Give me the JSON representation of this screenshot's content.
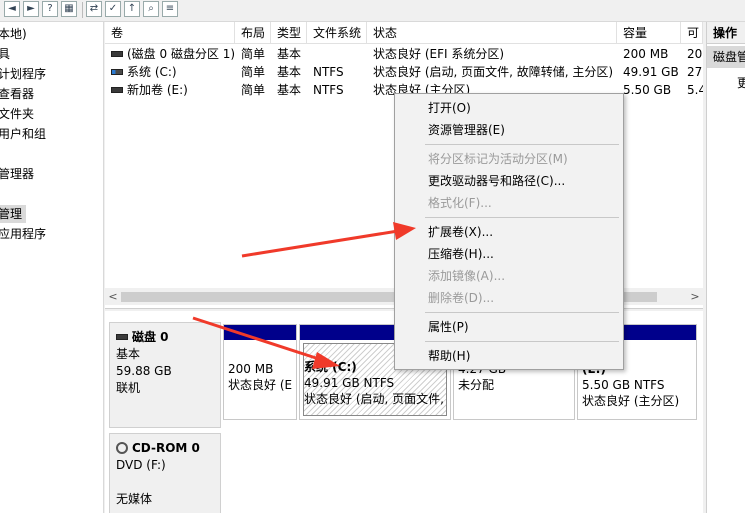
{
  "toolbar": {
    "icons": [
      "back-icon",
      "forward-icon",
      "help-icon",
      "refresh-icon",
      "rescan-icon",
      "check-icon",
      "folder-up-icon",
      "search-icon",
      "properties-icon"
    ]
  },
  "tree": {
    "items": [
      "本地)",
      "具",
      "计划程序",
      "查看器",
      "文件夹",
      "用户和组",
      "管理器",
      "管理",
      "应用程序"
    ]
  },
  "list": {
    "columns": [
      "卷",
      "布局",
      "类型",
      "文件系统",
      "状态",
      "容量",
      "可"
    ],
    "rows": [
      {
        "name": "(磁盘 0 磁盘分区 1)",
        "layout": "简单",
        "type": "基本",
        "fs": "",
        "status": "状态良好 (EFI 系统分区)",
        "capacity": "200 MB",
        "free": "20"
      },
      {
        "name": "系统 (C:)",
        "layout": "简单",
        "type": "基本",
        "fs": "NTFS",
        "status": "状态良好 (启动, 页面文件, 故障转储, 主分区)",
        "capacity": "49.91 GB",
        "free": "27"
      },
      {
        "name": "新加卷 (E:)",
        "layout": "简单",
        "type": "基本",
        "fs": "NTFS",
        "status": "状态良好 (主分区)",
        "capacity": "5.50 GB",
        "free": "5.4"
      }
    ],
    "scroll_left": "<",
    "scroll_right": ">"
  },
  "actions": {
    "header": "操作",
    "sub": "磁盘管",
    "item": "更"
  },
  "disks": [
    {
      "name": "磁盘 0",
      "type": "基本",
      "size": "59.88 GB",
      "status": "联机"
    },
    {
      "name": "CD-ROM 0",
      "type": "DVD (F:)",
      "status": "无媒体"
    }
  ],
  "partitions": [
    {
      "line1": "",
      "line2": "200 MB",
      "line3": "状态良好 (E"
    },
    {
      "line1": "系统 (C:)",
      "line2": "49.91 GB NTFS",
      "line3": "状态良好 (启动, 页面文件,"
    },
    {
      "line1": "",
      "line2": "4.27 GB",
      "line3": "未分配"
    },
    {
      "line1": "(E:)",
      "line2": "5.50 GB NTFS",
      "line3": "状态良好 (主分区)"
    }
  ],
  "context_menu": {
    "items": [
      {
        "label": "打开(O)",
        "enabled": true
      },
      {
        "label": "资源管理器(E)",
        "enabled": true
      },
      {
        "label": "将分区标记为活动分区(M)",
        "enabled": false
      },
      {
        "label": "更改驱动器号和路径(C)...",
        "enabled": true
      },
      {
        "label": "格式化(F)...",
        "enabled": false
      },
      {
        "label": "扩展卷(X)...",
        "enabled": true
      },
      {
        "label": "压缩卷(H)...",
        "enabled": true
      },
      {
        "label": "添加镜像(A)...",
        "enabled": false
      },
      {
        "label": "删除卷(D)...",
        "enabled": false
      },
      {
        "label": "属性(P)",
        "enabled": true
      },
      {
        "label": "帮助(H)",
        "enabled": true
      }
    ]
  },
  "colors": {
    "partition_bar": "#00008b",
    "arrow": "#f03a2a",
    "selection": "#d9d9d9"
  }
}
